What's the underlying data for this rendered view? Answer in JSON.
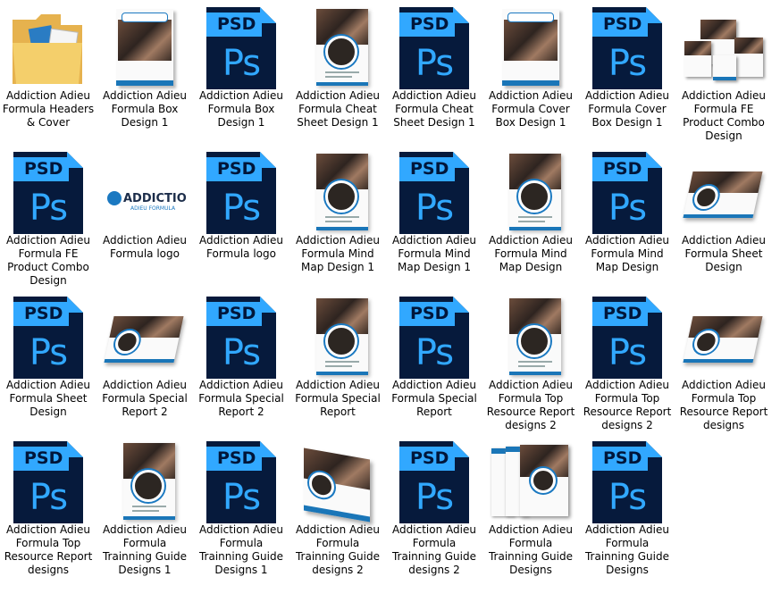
{
  "items": [
    {
      "label": "Addiction Adieu Formula Headers & Cover",
      "icon": "folder-icon",
      "kind": "folder"
    },
    {
      "label": "Addiction Adieu Formula Box Design 1",
      "icon": "box-design-thumbnail",
      "kind": "box"
    },
    {
      "label": "Addiction Adieu Formula Box Design 1",
      "icon": "psd-file-icon",
      "kind": "psd"
    },
    {
      "label": "Addiction Adieu Formula Cheat Sheet Design 1",
      "icon": "cheat-sheet-thumbnail",
      "kind": "sheet"
    },
    {
      "label": "Addiction Adieu Formula Cheat Sheet Design 1",
      "icon": "psd-file-icon",
      "kind": "psd"
    },
    {
      "label": "Addiction Adieu Formula Cover Box Design 1",
      "icon": "cover-box-thumbnail",
      "kind": "box"
    },
    {
      "label": "Addiction Adieu Formula Cover Box Design 1",
      "icon": "psd-file-icon",
      "kind": "psd"
    },
    {
      "label": "Addiction Adieu Formula FE Product Combo Design",
      "icon": "product-combo-thumbnail",
      "kind": "combo"
    },
    {
      "label": "Addiction Adieu Formula FE Product Combo Design",
      "icon": "psd-file-icon",
      "kind": "psd"
    },
    {
      "label": "Addiction Adieu Formula logo",
      "icon": "logo-thumbnail",
      "kind": "logo"
    },
    {
      "label": "Addiction Adieu Formula logo",
      "icon": "psd-file-icon",
      "kind": "psd"
    },
    {
      "label": "Addiction Adieu Formula Mind Map Design 1",
      "icon": "mind-map-thumbnail",
      "kind": "sheet"
    },
    {
      "label": "Addiction Adieu Formula Mind Map Design 1",
      "icon": "psd-file-icon",
      "kind": "psd"
    },
    {
      "label": "Addiction Adieu Formula Mind Map Design",
      "icon": "mind-map-thumbnail",
      "kind": "sheet"
    },
    {
      "label": "Addiction Adieu Formula Mind Map Design",
      "icon": "psd-file-icon",
      "kind": "psd"
    },
    {
      "label": "Addiction Adieu Formula Sheet Design",
      "icon": "sheet-design-thumbnail",
      "kind": "flat"
    },
    {
      "label": "Addiction Adieu Formula Sheet Design",
      "icon": "psd-file-icon",
      "kind": "psd"
    },
    {
      "label": "Addiction Adieu Formula Special Report 2",
      "icon": "special-report-thumbnail",
      "kind": "flat"
    },
    {
      "label": "Addiction Adieu Formula Special Report 2",
      "icon": "psd-file-icon",
      "kind": "psd"
    },
    {
      "label": "Addiction Adieu Formula Special Report",
      "icon": "special-report-thumbnail",
      "kind": "sheet"
    },
    {
      "label": "Addiction Adieu Formula Special Report",
      "icon": "psd-file-icon",
      "kind": "psd"
    },
    {
      "label": "Addiction Adieu Formula Top Resource Report designs 2",
      "icon": "resource-report-thumbnail",
      "kind": "sheet"
    },
    {
      "label": "Addiction Adieu Formula Top Resource Report designs 2",
      "icon": "psd-file-icon",
      "kind": "psd"
    },
    {
      "label": "Addiction Adieu Formula Top Resource Report designs",
      "icon": "resource-report-thumbnail",
      "kind": "flat"
    },
    {
      "label": "Addiction Adieu Formula Top Resource Report designs",
      "icon": "psd-file-icon",
      "kind": "psd"
    },
    {
      "label": "Addiction Adieu Formula Trainning Guide Designs 1",
      "icon": "training-guide-thumbnail",
      "kind": "sheet"
    },
    {
      "label": "Addiction Adieu Formula Trainning Guide Designs 1",
      "icon": "psd-file-icon",
      "kind": "psd"
    },
    {
      "label": "Addiction Adieu Formula Trainning Guide designs 2",
      "icon": "training-guide-thumbnail",
      "kind": "book"
    },
    {
      "label": "Addiction Adieu Formula Trainning Guide designs 2",
      "icon": "psd-file-icon",
      "kind": "psd"
    },
    {
      "label": "Addiction Adieu Formula Trainning Guide Designs",
      "icon": "training-guide-thumbnail",
      "kind": "books"
    },
    {
      "label": "Addiction Adieu Formula Trainning Guide Designs",
      "icon": "psd-file-icon",
      "kind": "psd"
    }
  ],
  "psd_tag": "PSD",
  "psd_logo": "Ps",
  "logo_text": "ADDICTION",
  "logo_sub": "ADIEU FORMULA",
  "colors": {
    "psd_blue": "#31a8ff",
    "psd_dark": "#00163a",
    "accent": "#1b79c1"
  }
}
